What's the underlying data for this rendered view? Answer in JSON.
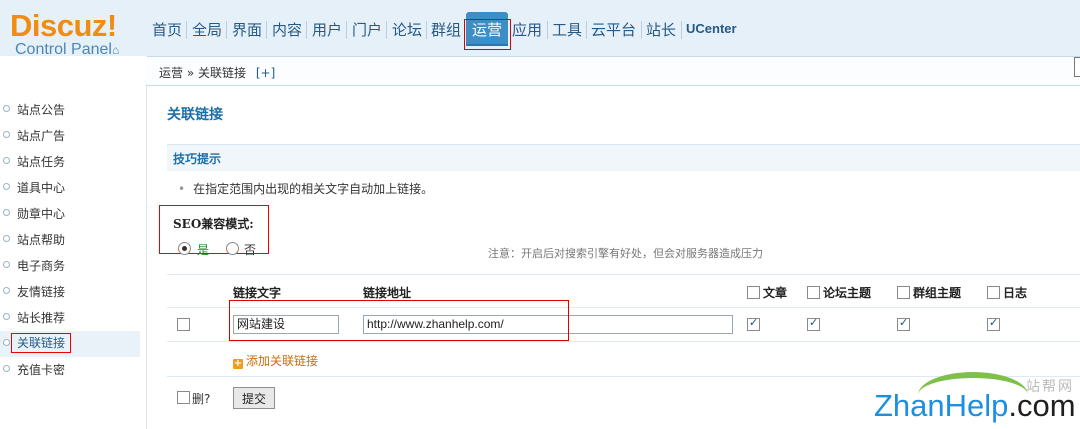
{
  "logo": {
    "title": "Discuz!",
    "subtitle": "Control Panel"
  },
  "nav": {
    "items": [
      "首页",
      "全局",
      "界面",
      "内容",
      "用户",
      "门户",
      "论坛",
      "群组",
      "运营",
      "应用",
      "工具",
      "云平台",
      "站长",
      "UCenter"
    ],
    "active": "运营"
  },
  "breadcrumb": {
    "section": "运营",
    "sep": "»",
    "page": "关联链接",
    "plus": "[+]"
  },
  "sidebar": {
    "items": [
      "站点公告",
      "站点广告",
      "站点任务",
      "道具中心",
      "勋章中心",
      "站点帮助",
      "电子商务",
      "友情链接",
      "站长推荐",
      "关联链接",
      "充值卡密"
    ],
    "active": "关联链接"
  },
  "main": {
    "title": "关联链接",
    "tips_title": "技巧提示",
    "tip": "在指定范围内出现的相关文字自动加上链接。",
    "seo": {
      "label": "SEO兼容模式:",
      "yes": "是",
      "no": "否",
      "selected": "是",
      "note": "注意：开启后对搜索引擎有好处，但会对服务器造成压力"
    },
    "table": {
      "col_text": "链接文字",
      "col_url": "链接地址",
      "col_article": "文章",
      "col_forum": "论坛主题",
      "col_group": "群组主题",
      "col_blog": "日志",
      "rows": [
        {
          "text": "网站建设",
          "url": "http://www.zhanhelp.com/",
          "article": true,
          "forum": true,
          "group": true,
          "blog": true
        }
      ]
    },
    "add_link": "添加关联链接",
    "delete_label": "删?",
    "submit": "提交"
  },
  "watermark": {
    "cn": "站帮网",
    "brand": "ZhanHelp",
    "tld": ".com"
  },
  "colors": {
    "accent": "#3e8ec6",
    "logo": "#f08c12",
    "highlight": "#dd0000"
  }
}
